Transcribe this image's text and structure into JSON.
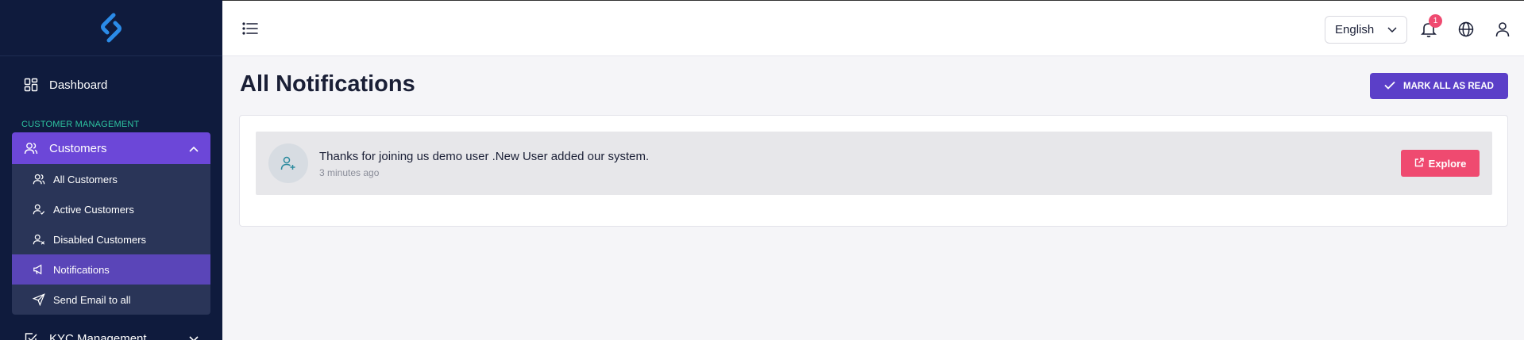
{
  "sidebar": {
    "logo_icon": "brand-logo-icon",
    "dashboard": {
      "label": "Dashboard",
      "icon": "grid-icon"
    },
    "section_label": "CUSTOMER MANAGEMENT",
    "customers": {
      "label": "Customers",
      "icon": "users-icon",
      "expanded": true
    },
    "submenu": [
      {
        "label": "All Customers",
        "icon": "users-icon",
        "active": false
      },
      {
        "label": "Active Customers",
        "icon": "user-check-icon",
        "active": false
      },
      {
        "label": "Disabled Customers",
        "icon": "user-x-icon",
        "active": false
      },
      {
        "label": "Notifications",
        "icon": "megaphone-icon",
        "active": true
      },
      {
        "label": "Send Email to all",
        "icon": "send-icon",
        "active": false
      }
    ],
    "kyc": {
      "label": "KYC Management",
      "icon": "checkbox-icon"
    }
  },
  "topbar": {
    "language": "English",
    "notification_count": "1"
  },
  "main": {
    "title": "All Notifications",
    "mark_all_label": "MARK ALL AS READ",
    "notifications": [
      {
        "message": "Thanks for joining us demo user .New User added our system.",
        "time": "3 minutes ago",
        "action_label": "Explore"
      }
    ]
  },
  "colors": {
    "sidebar_bg": "#0f1b3d",
    "accent_purple": "#6c47d8",
    "section_green": "#2ec4a0",
    "explore_pink": "#ef4a70"
  }
}
